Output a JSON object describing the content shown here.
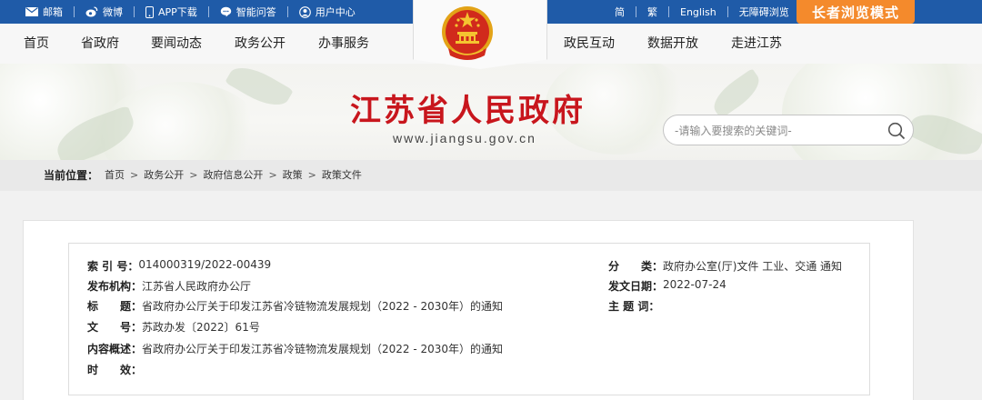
{
  "topbar": {
    "links": [
      {
        "label": "邮箱",
        "icon": "mail-icon"
      },
      {
        "label": "微博",
        "icon": "weibo-icon"
      },
      {
        "label": "APP下载",
        "icon": "phone-icon"
      },
      {
        "label": "智能问答",
        "icon": "chat-icon"
      },
      {
        "label": "用户中心",
        "icon": "user-icon"
      }
    ],
    "lang": [
      "简",
      "繁",
      "English",
      "无障碍浏览"
    ],
    "elder_mode": "长者浏览模式"
  },
  "nav": {
    "left": [
      "首页",
      "省政府",
      "要闻动态",
      "政务公开",
      "办事服务"
    ],
    "right": [
      "政民互动",
      "数据开放",
      "走进江苏"
    ]
  },
  "banner": {
    "title": "江苏省人民政府",
    "url": "www.jiangsu.gov.cn",
    "search_placeholder": "-请输入要搜索的关键词-"
  },
  "breadcrumb": {
    "label": "当前位置：",
    "items": [
      "首页",
      "政务公开",
      "政府信息公开",
      "政策",
      "政策文件"
    ]
  },
  "meta": {
    "left": [
      {
        "key": "索 引 号：",
        "value": "014000319/2022-00439"
      },
      {
        "key": "发布机构：",
        "value": "江苏省人民政府办公厅"
      },
      {
        "key": "标　　题：",
        "value": "省政府办公厅关于印发江苏省冷链物流发展规划（2022 - 2030年）的通知"
      },
      {
        "key": "文　　号：",
        "value": "苏政办发〔2022〕61号"
      },
      {
        "key": "内容概述：",
        "value": "省政府办公厅关于印发江苏省冷链物流发展规划（2022 - 2030年）的通知"
      },
      {
        "key": "时　　效：",
        "value": ""
      }
    ],
    "right": [
      {
        "key": "分　　类：",
        "value": "政府办公室(厅)文件 工业、交通 通知"
      },
      {
        "key": "发文日期：",
        "value": "2022-07-24"
      },
      {
        "key": "主 题 词：",
        "value": ""
      }
    ]
  },
  "colors": {
    "topbar": "#1f5ba8",
    "accent": "#f48a2c",
    "title_red": "#c8161d"
  }
}
